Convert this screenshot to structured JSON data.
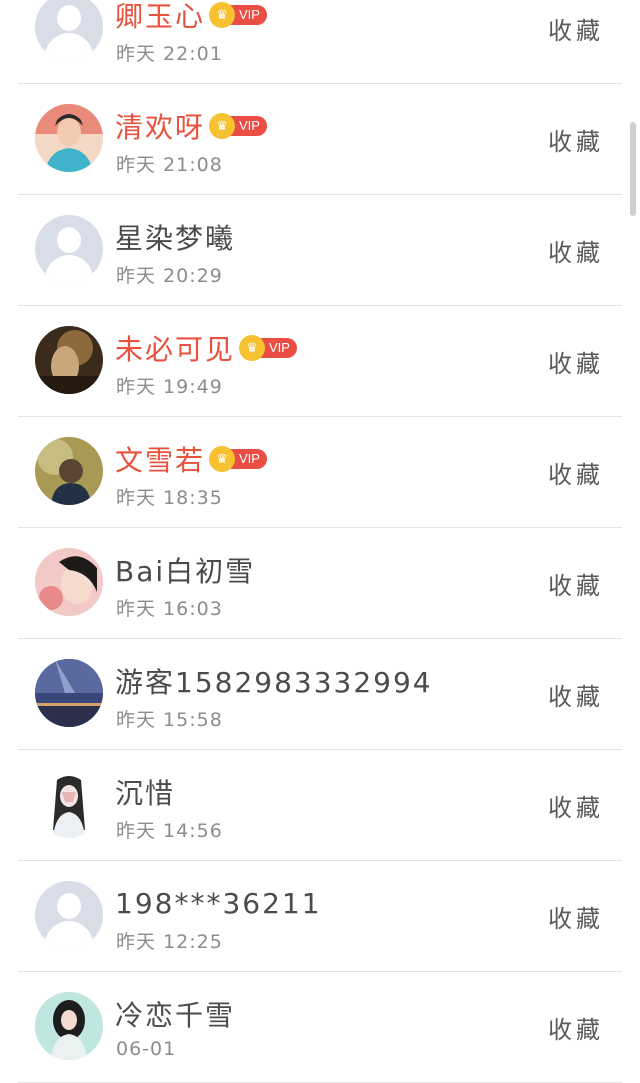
{
  "favorite_label": "收藏",
  "vip_label": "VIP",
  "colors": {
    "vip_name": "#e8513c",
    "vip_tag": "#ea4d44",
    "crown": "#f6c232",
    "normal_name": "#4b4b4b",
    "time": "#8c8c8c"
  },
  "users": [
    {
      "name": "卿玉心",
      "time": "昨天 22:01",
      "vip": true,
      "avatar": "default"
    },
    {
      "name": "清欢呀",
      "time": "昨天 21:08",
      "vip": true,
      "avatar": "photo-boy-blue"
    },
    {
      "name": "星染梦曦",
      "time": "昨天 20:29",
      "vip": false,
      "avatar": "default"
    },
    {
      "name": "未必可见",
      "time": "昨天 19:49",
      "vip": true,
      "avatar": "photo-dark-sepia"
    },
    {
      "name": "文雪若",
      "time": "昨天 18:35",
      "vip": true,
      "avatar": "photo-back-view"
    },
    {
      "name": "Bai白初雪",
      "time": "昨天 16:03",
      "vip": false,
      "avatar": "photo-girl-pink"
    },
    {
      "name": "游客1582983332994",
      "time": "昨天 15:58",
      "vip": false,
      "avatar": "photo-night-sky"
    },
    {
      "name": "沉惜",
      "time": "昨天 14:56",
      "vip": false,
      "avatar": "photo-masked-girl"
    },
    {
      "name": "198***36211",
      "time": "昨天 12:25",
      "vip": false,
      "avatar": "default"
    },
    {
      "name": "冷恋千雪",
      "time": "06-01",
      "vip": false,
      "avatar": "photo-girl-teal"
    }
  ]
}
